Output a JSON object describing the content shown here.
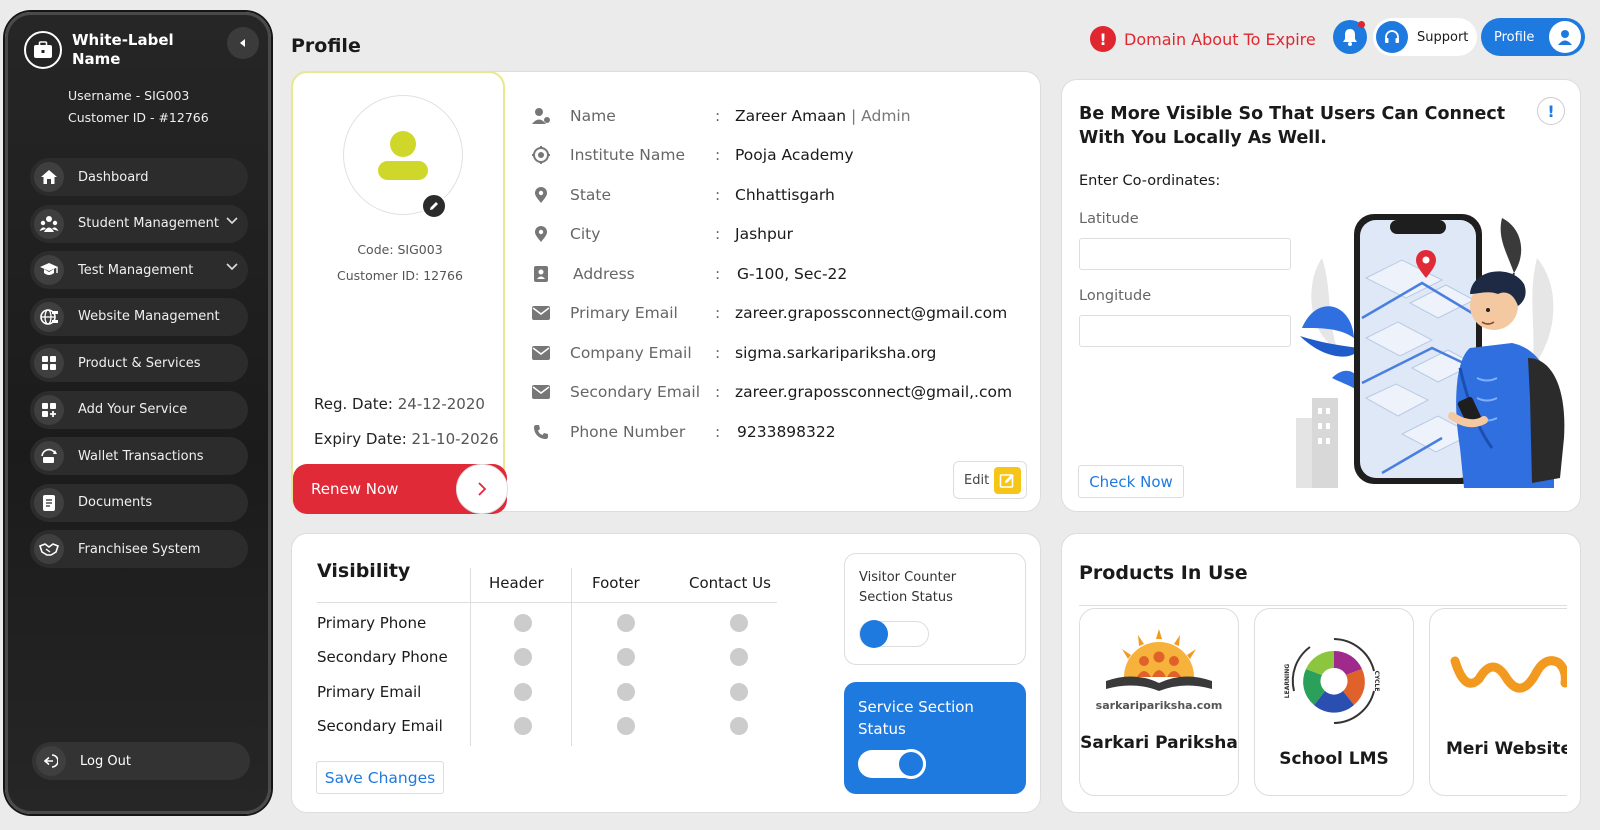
{
  "sidebar": {
    "brand_name": "White-Label Name",
    "username": "Username - SIG003",
    "customer_id": "Customer ID - #12766",
    "items": [
      {
        "label": "Dashboard",
        "icon": "home-icon"
      },
      {
        "label": "Student Management",
        "icon": "students-icon",
        "expandable": true
      },
      {
        "label": "Test Management",
        "icon": "graduation-cap-icon",
        "expandable": true
      },
      {
        "label": "Website Management",
        "icon": "globe-icon"
      },
      {
        "label": "Product & Services",
        "icon": "grid-icon"
      },
      {
        "label": "Add Your Service",
        "icon": "add-grid-icon"
      },
      {
        "label": "Wallet Transactions",
        "icon": "wallet-icon"
      },
      {
        "label": "Documents",
        "icon": "document-icon"
      },
      {
        "label": "Franchisee System",
        "icon": "handshake-icon"
      }
    ],
    "logout": "Log Out"
  },
  "header": {
    "title": "Profile",
    "alert": "Domain About To Expire",
    "support": "Support",
    "profile": "Profile"
  },
  "profile": {
    "code": "Code: SIG003",
    "customer_id": "Customer ID: 12766",
    "reg_label": "Reg. Date:",
    "reg_date": "24-12-2020",
    "expiry_label": "Expiry Date:",
    "expiry_date": "21-10-2026",
    "renew": "Renew Now",
    "edit": "Edit",
    "fields": [
      {
        "label": "Name",
        "value": "Zareer Amaan",
        "sub": "Admin",
        "icon": "user-icon"
      },
      {
        "label": "Institute Name",
        "value": "Pooja Academy",
        "icon": "institute-icon"
      },
      {
        "label": "State",
        "value": "Chhattisgarh",
        "icon": "location-pin-icon"
      },
      {
        "label": "City",
        "value": "Jashpur",
        "icon": "location-pin-icon"
      },
      {
        "label": "Address",
        "value": "G-100, Sec-22",
        "icon": "address-book-icon"
      },
      {
        "label": "Primary Email",
        "value": "zareer.grapossconnect@gmail.com",
        "icon": "mail-icon"
      },
      {
        "label": "Company Email",
        "value": "sigma.sarkaripariksha.org",
        "icon": "mail-icon"
      },
      {
        "label": "Secondary Email",
        "value": "zareer.grapossconnect@gmail,.com",
        "icon": "mail-icon"
      },
      {
        "label": "Phone Number",
        "value": "9233898322",
        "icon": "phone-icon"
      }
    ],
    "separator": "|"
  },
  "geo": {
    "title": "Be More Visible So That Users Can Connect With You Locally As Well.",
    "info": "!",
    "enter": "Enter Co-ordinates:",
    "latitude_label": "Latitude",
    "latitude_value": "",
    "longitude_label": "Longitude",
    "longitude_value": "",
    "check": "Check Now"
  },
  "visibility": {
    "title": "Visibility",
    "columns": [
      "Header",
      "Footer",
      "Contact Us"
    ],
    "rows": [
      "Primary Phone",
      "Secondary Phone",
      "Primary Email",
      "Secondary Email"
    ],
    "save": "Save Changes",
    "visitor_counter": "Visitor Counter Section Status",
    "visitor_counter_on": false,
    "service_section": "Service Section Status",
    "service_section_on": true
  },
  "products": {
    "title": "Products In Use",
    "items": [
      {
        "name": "Sarkari Pariksha",
        "logo_text": "sarkaripariksha.com"
      },
      {
        "name": "School LMS",
        "logo_text": "LEARNING CYCLE"
      },
      {
        "name": "Meri Website"
      }
    ]
  },
  "colors": {
    "accent": "#1f7ae0",
    "danger": "#e02a38",
    "highlight": "#e6e98f",
    "avatar": "#cfd82a"
  }
}
